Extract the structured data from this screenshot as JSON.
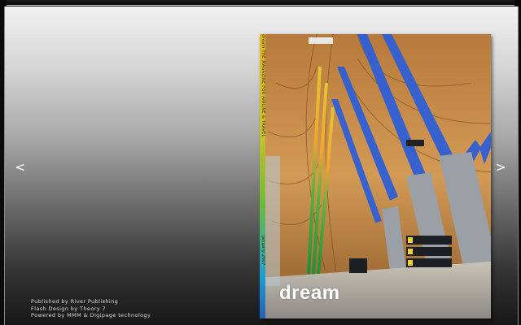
{
  "navigation": {
    "prev_label": "<",
    "next_label": ">"
  },
  "credits": {
    "published": "Published by River Publishing",
    "flash": "Flash Design by Theory 7",
    "powered": "Powered by MMM & Digipage technology"
  },
  "magazine": {
    "title": "dream",
    "spine": "dream THE MAGAZINE FOR AIRLINE & TRAVEL",
    "spine_date": "January 2007"
  },
  "colors": {
    "accent_blue": "#2f6fe0",
    "wood": "#c08a48"
  }
}
